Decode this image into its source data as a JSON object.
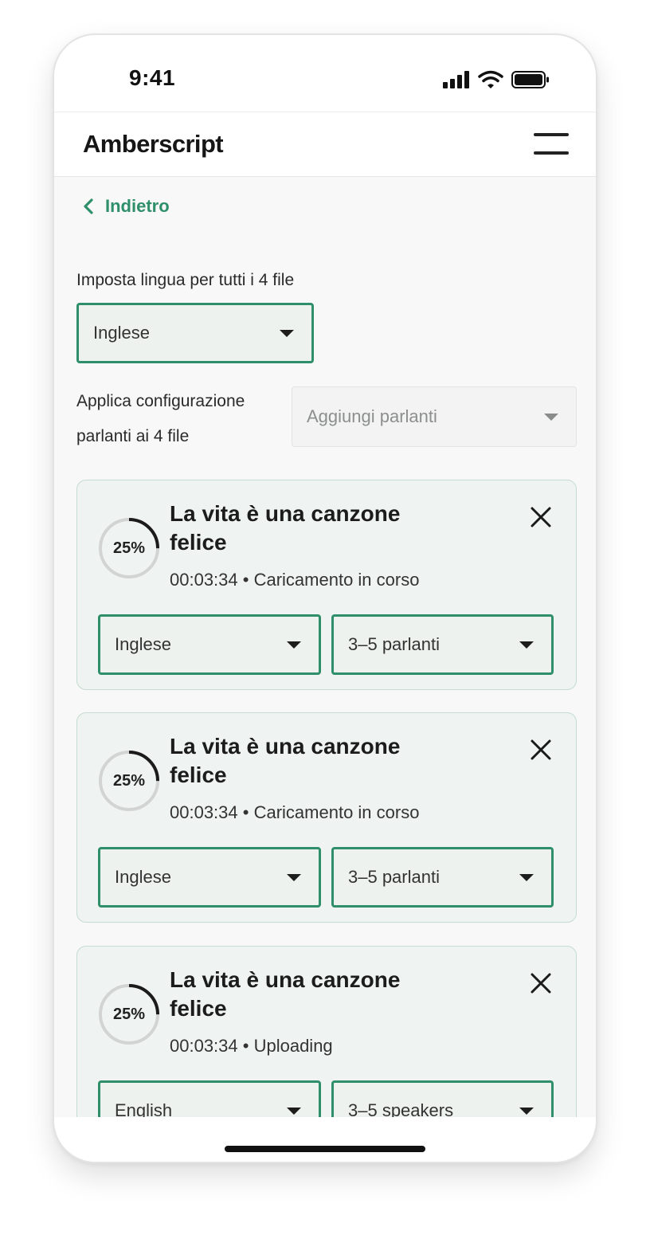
{
  "status_bar": {
    "time": "9:41"
  },
  "header": {
    "brand": "Amberscript"
  },
  "back_link": {
    "label": "Indietro"
  },
  "global": {
    "language_label": "Imposta lingua per tutti i 4 file",
    "language_value": "Inglese",
    "speaker_label": "Applica configurazione parlanti ai 4 file",
    "speaker_placeholder": "Aggiungi parlanti"
  },
  "files": [
    {
      "title": "La vita è una canzone felice",
      "progress": 25,
      "progress_label": "25%",
      "duration": "00:03:34",
      "status": "Caricamento in corso",
      "language": "Inglese",
      "speakers": "3–5 parlanti"
    },
    {
      "title": "La vita è una canzone felice",
      "progress": 25,
      "progress_label": "25%",
      "duration": "00:03:34",
      "status": "Caricamento in corso",
      "language": "Inglese",
      "speakers": "3–5 parlanti"
    },
    {
      "title": "La vita è una canzone felice",
      "progress": 25,
      "progress_label": "25%",
      "duration": "00:03:34",
      "status": "Uploading",
      "language": "English",
      "speakers": "3–5 speakers"
    }
  ],
  "meta_separator": "•",
  "colors": {
    "accent": "#2f8f6a",
    "card_bg": "#eff3f1",
    "card_border": "#c5dcd0",
    "progress_track": "#d2d4d3",
    "progress_arc": "#1b1b1b"
  },
  "icons": [
    "signal-icon",
    "wifi-icon",
    "battery-icon",
    "menu-icon",
    "chevron-left-icon",
    "caret-down-icon",
    "close-icon"
  ]
}
